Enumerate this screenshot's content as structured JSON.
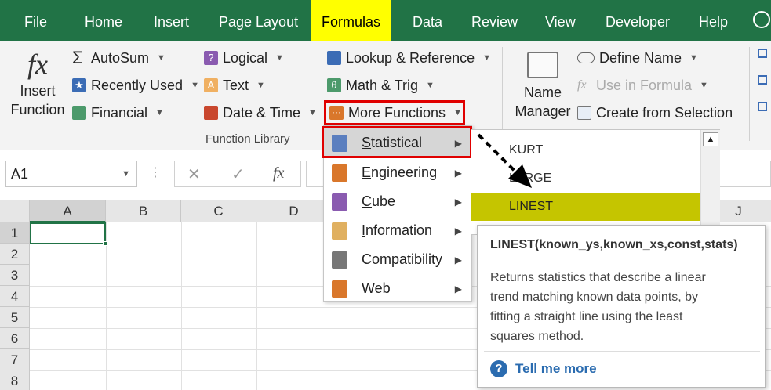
{
  "tabs": [
    "File",
    "Home",
    "Insert",
    "Page Layout",
    "Formulas",
    "Data",
    "Review",
    "View",
    "Developer",
    "Help"
  ],
  "active_tab": "Formulas",
  "ribbon": {
    "insert_function": [
      "Insert",
      "Function"
    ],
    "autosum": "AutoSum",
    "recently_used": "Recently Used",
    "financial": "Financial",
    "logical": "Logical",
    "text": "Text",
    "date_time": "Date & Time",
    "lookup": "Lookup & Reference",
    "math": "Math & Trig",
    "more_functions": "More Functions",
    "group_label": "Function Library",
    "name_manager": [
      "Name",
      "Manager"
    ],
    "define_name": "Define Name",
    "use_in_formula": "Use in Formula",
    "create_from_selection": "Create from Selection"
  },
  "formula_bar": {
    "name_box": "A1",
    "cancel": "✕",
    "enter": "✓",
    "fx": "fx"
  },
  "columns": [
    "A",
    "B",
    "C",
    "D",
    "J"
  ],
  "rows": [
    "1",
    "2",
    "3",
    "4",
    "5",
    "6",
    "7",
    "8"
  ],
  "more_functions_menu": [
    {
      "pre": "",
      "u": "S",
      "post": "tatistical",
      "color": "#5b7fbf"
    },
    {
      "pre": "",
      "u": "E",
      "post": "ngineering",
      "color": "#d9772b"
    },
    {
      "pre": "",
      "u": "C",
      "post": "ube",
      "color": "#8a5bb0"
    },
    {
      "pre": "",
      "u": "I",
      "post": "nformation",
      "color": "#e0b060"
    },
    {
      "pre": "C",
      "u": "o",
      "post": "mpatibility",
      "color": "#777777"
    },
    {
      "pre": "",
      "u": "W",
      "post": "eb",
      "color": "#d9772b"
    }
  ],
  "statistical_list": [
    "KURT",
    "LARGE",
    "LINEST"
  ],
  "tooltip": {
    "title": "LINEST(known_ys,known_xs,const,stats)",
    "body": [
      "Returns statistics that describe a linear",
      "trend matching known data points, by",
      "fitting a straight line using the least",
      "squares method."
    ],
    "link": "Tell me more"
  },
  "colors": {
    "excel_green": "#217346",
    "highlight": "#ffff00",
    "selected_item": "#c5c500",
    "red_box": "#e00000"
  }
}
